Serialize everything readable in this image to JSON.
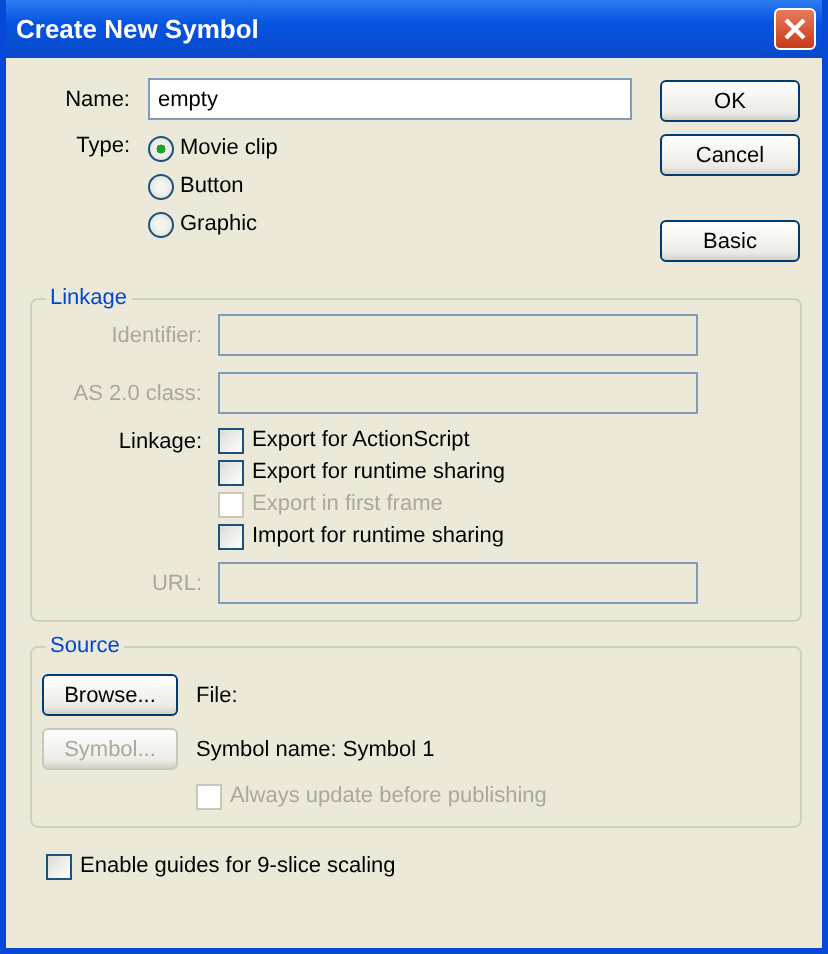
{
  "window": {
    "title": "Create New Symbol"
  },
  "name": {
    "label": "Name:",
    "value": "empty"
  },
  "type": {
    "label": "Type:",
    "options": [
      {
        "label": "Movie clip",
        "selected": true
      },
      {
        "label": "Button",
        "selected": false
      },
      {
        "label": "Graphic",
        "selected": false
      }
    ]
  },
  "buttons": [
    {
      "label": "OK"
    },
    {
      "label": "Cancel"
    },
    {
      "label": "Basic"
    }
  ],
  "linkage": {
    "title": "Linkage",
    "fields": [
      {
        "label": "Identifier:",
        "disabled": true
      },
      {
        "label": "AS 2.0 class:",
        "disabled": true
      }
    ],
    "options_label": "Linkage:",
    "checkboxes": [
      {
        "label": "Export for ActionScript",
        "checked": false,
        "disabled": false
      },
      {
        "label": "Export for runtime sharing",
        "checked": false,
        "disabled": false
      },
      {
        "label": "Export in first frame",
        "checked": false,
        "disabled": true
      },
      {
        "label": "Import for runtime sharing",
        "checked": false,
        "disabled": false
      }
    ],
    "url": {
      "label": "URL:",
      "disabled": true
    }
  },
  "source": {
    "title": "Source",
    "browse": {
      "label": "Browse...",
      "disabled": false
    },
    "file_label": "File:",
    "symbol": {
      "label": "Symbol...",
      "disabled": true
    },
    "symbol_name": "Symbol name: Symbol 1",
    "always_update": {
      "label": "Always update before publishing",
      "checked": false,
      "disabled": true
    }
  },
  "guides": {
    "label": "Enable guides for 9-slice scaling",
    "checked": false
  }
}
